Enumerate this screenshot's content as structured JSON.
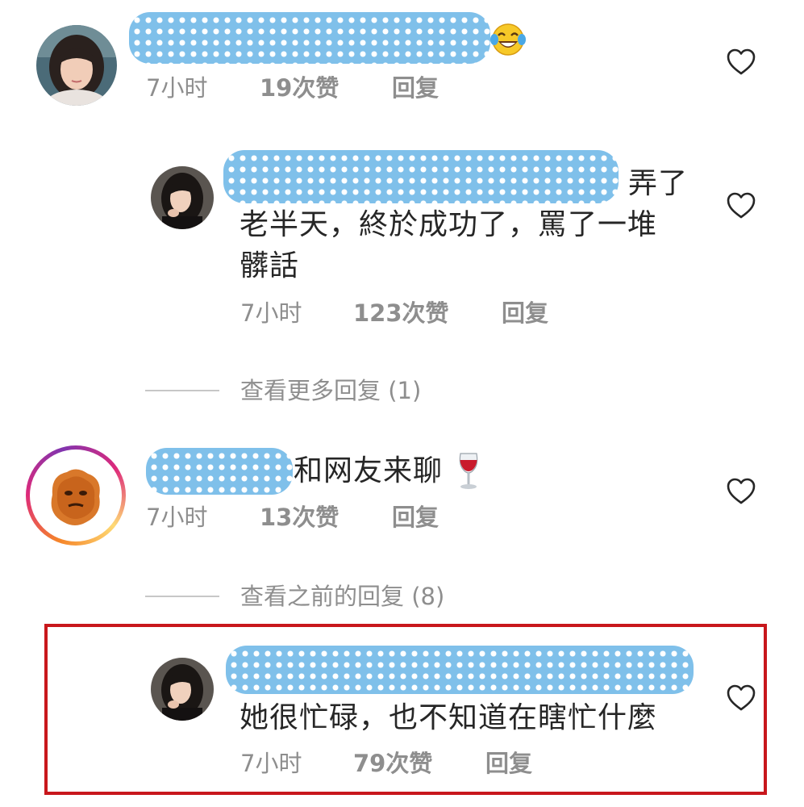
{
  "comments": [
    {
      "redacted_name": "",
      "text_lines": [],
      "trailing_emoji": "laughing-tears-emoji",
      "time": "7小时",
      "likes": "19次赞",
      "reply": "回复"
    },
    {
      "redacted_name": "",
      "text_lines": [
        "弄了",
        "老半天，終於成功了，罵了一堆",
        "髒話"
      ],
      "time": "7小时",
      "likes": "123次赞",
      "reply": "回复"
    },
    {
      "redacted_name": "",
      "text_lines": [
        "和网友来聊"
      ],
      "trailing_emoji": "wine-glass-emoji",
      "time": "7小时",
      "likes": "13次赞",
      "reply": "回复"
    },
    {
      "redacted_name": "",
      "text_lines": [
        "她很忙碌，也不知道在瞎忙什麼"
      ],
      "time": "7小时",
      "likes": "79次赞",
      "reply": "回复"
    }
  ],
  "view_more_replies": "查看更多回复 (1)",
  "view_previous_replies": "查看之前的回复 (8)",
  "colors": {
    "redaction_blue": "#7fc0ea",
    "highlight_red": "#c8171c",
    "meta_gray": "#8e8e8e",
    "text": "#262626"
  }
}
